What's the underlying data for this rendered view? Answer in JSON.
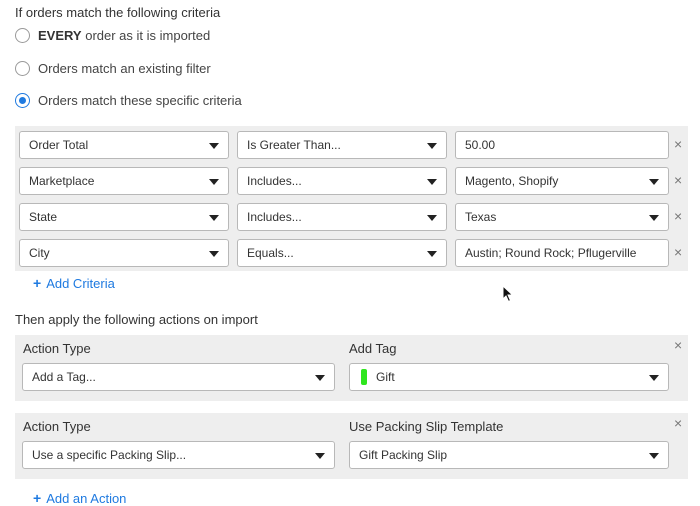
{
  "trigger": {
    "title": "If orders match the following criteria",
    "options": [
      {
        "bold": "EVERY",
        "label": "order as it is imported",
        "selected": false
      },
      {
        "bold": "",
        "label": "Orders match an existing filter",
        "selected": false
      },
      {
        "bold": "",
        "label": "Orders match these specific criteria",
        "selected": true
      }
    ]
  },
  "criteria": {
    "rows": [
      {
        "field": "Order Total",
        "operator": "Is Greater Than...",
        "value": "50.00"
      },
      {
        "field": "Marketplace",
        "operator": "Includes...",
        "value": "Magento, Shopify"
      },
      {
        "field": "State",
        "operator": "Includes...",
        "value": "Texas"
      },
      {
        "field": "City",
        "operator": "Equals...",
        "value": "Austin; Round Rock; Pflugerville"
      }
    ],
    "add_label": "Add Criteria",
    "remove_glyph": "×"
  },
  "actions": {
    "title": "Then apply the following actions on import",
    "items": [
      {
        "type_label": "Action Type",
        "type_value": "Add a Tag...",
        "param_label": "Add Tag",
        "param_value": "Gift"
      },
      {
        "type_label": "Action Type",
        "type_value": "Use a specific Packing Slip...",
        "param_label": "Use Packing Slip Template",
        "param_value": "Gift Packing Slip"
      }
    ],
    "add_label": "Add an Action",
    "tag_color": "#2ee61e"
  },
  "colors": {
    "accent": "#1f7ae0",
    "panel_bg": "#eeeeee"
  },
  "icons": {
    "plus": "+",
    "caret": "chevron-down-icon",
    "remove": "close-icon"
  }
}
